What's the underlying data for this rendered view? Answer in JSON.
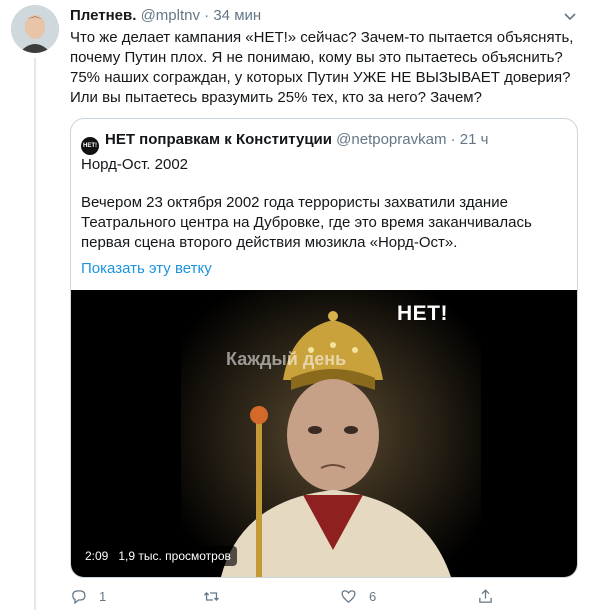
{
  "tweet": {
    "name": "Плетнев.",
    "handle": "@mpltnv",
    "separator": "·",
    "time": "34 мин",
    "lines": [
      "Что же делает кампания «НЕТ!» сейчас? Зачем-то пытается объяснять,",
      "почему Путин плох. Я не понимаю, кому вы это пытаетесь объяснить?",
      "75% наших сограждан, у которых Путин УЖЕ НЕ ВЫЗЫВАЕТ доверия?",
      "Или вы пытаетесь вразумить 25% тех, кто за него? Зачем?"
    ]
  },
  "quote": {
    "avatar_text": "НЕТ!",
    "name": "НЕТ поправкам к Конституции",
    "handle": "@netpopravkam",
    "separator": "·",
    "time": "21 ч",
    "line1": "Норд-Ост. 2002",
    "body_lines": [
      "Вечером 23 октября 2002 года террористы захватили здание",
      "Театрального центра на Дубровке, где это время заканчивалась",
      "первая сцена второго действия мюзикла «Норд-Ост»."
    ],
    "show_thread": "Показать эту ветку"
  },
  "media": {
    "overlay_logo": "НЕТ!",
    "watermark": "Каждый день",
    "duration": "2:09",
    "views": "1,9 тыс. просмотров"
  },
  "actions": {
    "reply_count": "1",
    "retweet_count": "",
    "like_count": "6",
    "icons": [
      "reply-icon",
      "retweet-icon",
      "like-icon",
      "share-icon"
    ]
  },
  "colors": {
    "link": "#1b95e0",
    "muted": "#657786",
    "border": "#ccd6dd"
  }
}
